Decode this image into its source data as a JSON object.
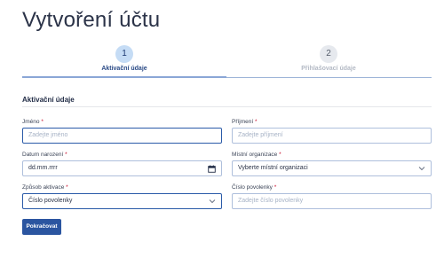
{
  "page": {
    "title": "Vytvoření účtu"
  },
  "stepper": {
    "steps": [
      {
        "number": "1",
        "label": "Aktivační údaje",
        "state": "active"
      },
      {
        "number": "2",
        "label": "Přihlašovací údaje",
        "state": "inactive"
      }
    ]
  },
  "section": {
    "title": "Aktivační údaje"
  },
  "form": {
    "jmeno": {
      "label": "Jméno",
      "required": "*",
      "placeholder": "Zadejte jméno",
      "value": ""
    },
    "prijmeni": {
      "label": "Příjmení",
      "required": "*",
      "placeholder": "Zadejte příjmení",
      "value": ""
    },
    "datum": {
      "label": "Datum narození",
      "required": "*",
      "placeholder": "dd.mm.rrrr",
      "value": ""
    },
    "org": {
      "label": "Místní organizace",
      "required": "*",
      "selected": "Vyberte místní organizaci"
    },
    "zpusob": {
      "label": "Způsob aktivace",
      "required": "*",
      "selected": "Číslo povolenky"
    },
    "cislo": {
      "label": "Číslo povolenky",
      "required": "*",
      "placeholder": "Zadejte číslo povolenky",
      "value": ""
    }
  },
  "actions": {
    "continue_label": "Pokračovat"
  },
  "icons": {
    "date": "calendar-icon",
    "select": "chevron-down-icon"
  },
  "colors": {
    "primary": "#2b55a0",
    "required": "#c8102e",
    "step_active": "#c5dcf5"
  }
}
